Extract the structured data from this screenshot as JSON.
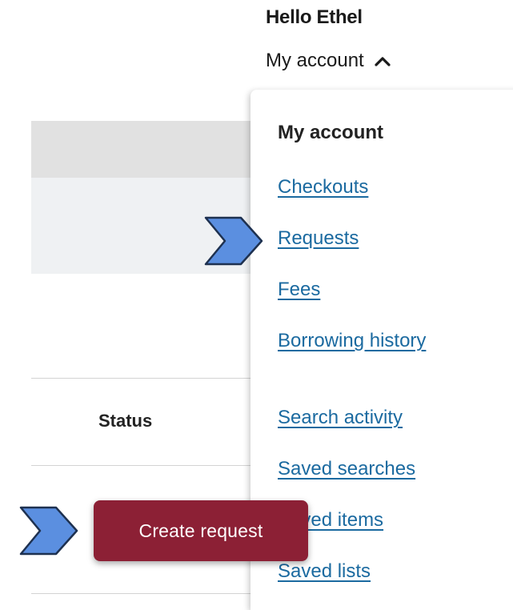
{
  "header": {
    "greeting": "Hello Ethel",
    "account_label": "My account",
    "account_icon": "chevron-up-icon"
  },
  "table": {
    "status_header": "Status"
  },
  "account_menu": {
    "title": "My account",
    "items": [
      {
        "label": "Checkouts"
      },
      {
        "label": "Requests"
      },
      {
        "label": "Fees"
      },
      {
        "label": "Borrowing history"
      },
      {
        "label": "Search activity"
      },
      {
        "label": "Saved searches"
      },
      {
        "label": "Saved items"
      },
      {
        "label": "Saved lists"
      }
    ]
  },
  "actions": {
    "create_request_label": "Create request"
  },
  "annotations": {
    "pointer_icon": "arrow-pointer-icon",
    "pointer_fill": "#5b8fe0",
    "pointer_stroke": "#1e3150"
  },
  "colors": {
    "link": "#1b6aa0",
    "button_bg": "#8c2035",
    "button_text": "#ffffff"
  }
}
